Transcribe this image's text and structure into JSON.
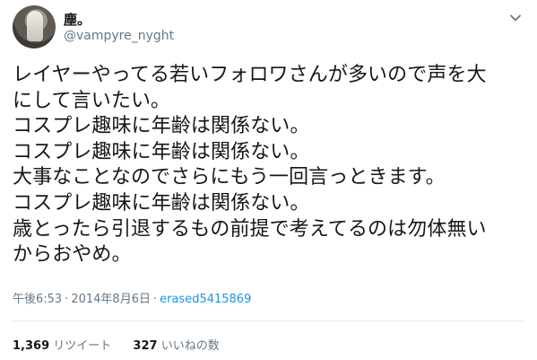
{
  "author": {
    "display_name": "塵。",
    "handle": "@vampyre_nyght",
    "avatar_icon": "avatar-photo"
  },
  "tweet": {
    "text": "レイヤーやってる若いフォロワさんが多いので声を大\nにして言いたい。\nコスプレ趣味に年齢は関係ない。\nコスプレ趣味に年齢は関係ない。\n大事なことなのでさらにもう一回言っときます。\nコスプレ趣味に年齢は関係ない。\n歳とったら引退するもの前提で考えてるのは勿体無い\nからおやめ。"
  },
  "meta": {
    "time": "午後6:53",
    "separator": "·",
    "date": "2014年8月6日",
    "source": "erased5415869"
  },
  "stats": {
    "retweets_count": "1,369",
    "retweets_label": "リツイート",
    "likes_count": "327",
    "likes_label": "いいねの数"
  },
  "icons": {
    "menu": "chevron-down-icon"
  },
  "colors": {
    "text": "#14171a",
    "secondary": "#657786",
    "link": "#1b95e0",
    "divider": "#e6ecf0"
  }
}
